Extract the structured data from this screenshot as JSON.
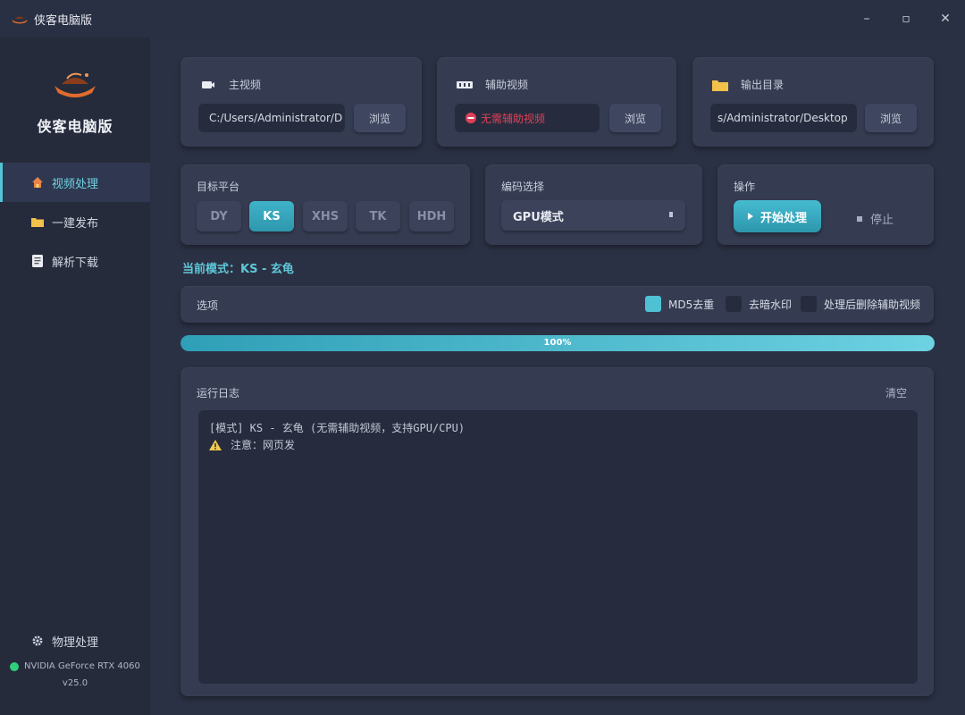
{
  "window": {
    "title": "侠客电脑版",
    "controls": {
      "minimize": "–",
      "maximize": "▫",
      "close": "✕"
    }
  },
  "sidebar": {
    "brand_name": "侠客电脑版",
    "items": [
      {
        "label": "视频处理",
        "icon": "home-icon",
        "active": true
      },
      {
        "label": "一建发布",
        "icon": "folder-icon",
        "active": false
      },
      {
        "label": "解析下载",
        "icon": "document-icon",
        "active": false
      }
    ],
    "bottom": {
      "physics_label": "物理处理",
      "gpu_name": "NVIDIA GeForce RTX 4060",
      "version": "v25.0"
    }
  },
  "main_video": {
    "title": "主视频",
    "path": "C:/Users/Administrator/D",
    "browse": "浏览"
  },
  "aux_video": {
    "title": "辅助视频",
    "status": "无需辅助视频",
    "browse": "浏览"
  },
  "output_dir": {
    "title": "输出目录",
    "path": "s/Administrator/Desktop",
    "browse": "浏览"
  },
  "platform": {
    "title": "目标平台",
    "options": [
      "DY",
      "KS",
      "XHS",
      "TK",
      "HDH"
    ],
    "selected": "KS"
  },
  "encoding": {
    "title": "编码选择",
    "selected": "GPU模式"
  },
  "operation": {
    "title": "操作",
    "start": "开始处理",
    "stop": "停止"
  },
  "current_mode": "当前模式：KS - 玄龟",
  "options": {
    "label": "选项",
    "checkboxes": [
      {
        "label": "MD5去重",
        "checked": true
      },
      {
        "label": "去暗水印",
        "checked": false
      },
      {
        "label": "处理后删除辅助视频",
        "checked": false
      }
    ]
  },
  "progress": {
    "value": 1.0,
    "text": "100%"
  },
  "log": {
    "title": "运行日志",
    "clear": "清空",
    "lines": [
      "[模式] KS - 玄龟 (无需辅助视频，支持GPU/CPU)",
      "注意：网页发"
    ]
  },
  "colors": {
    "accent": "#4fc1d4",
    "background": "#2b3144",
    "sidebar": "#252b3b",
    "card": "#353c52",
    "gpu_status": "#2fcf7b",
    "warning": "#f2c94c",
    "error": "#e0405a"
  }
}
